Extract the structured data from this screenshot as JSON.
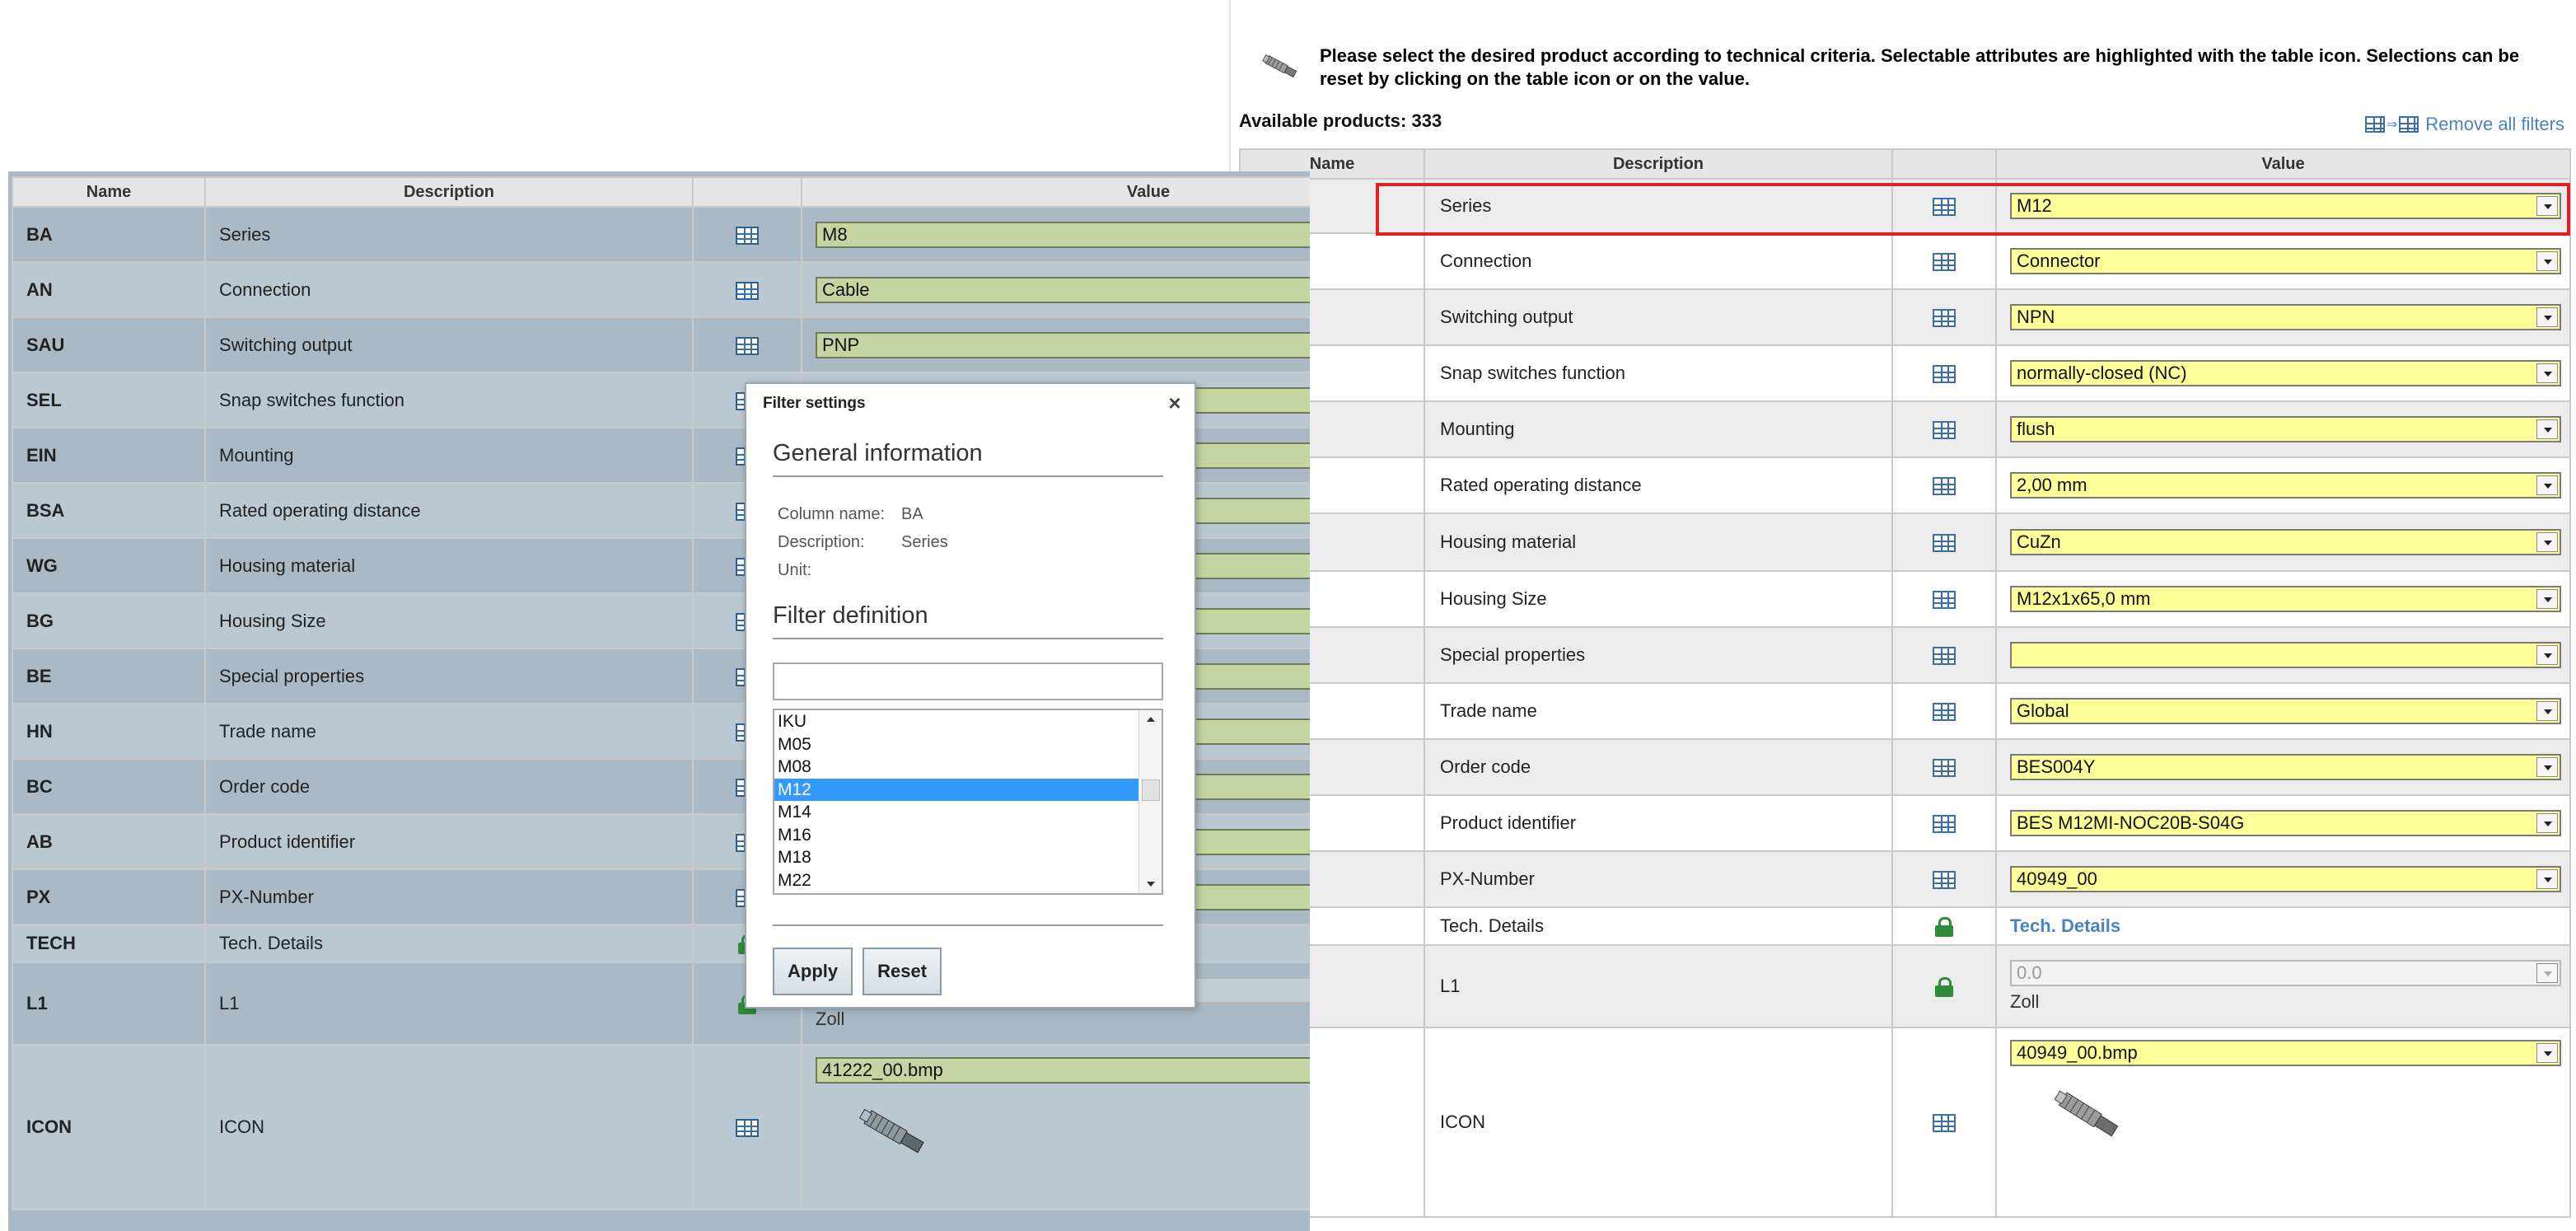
{
  "intro": {
    "text": "Please select the desired product according to technical criteria. Selectable attributes are highlighted with the table icon. Selections can be reset by clicking on the table icon or on the value."
  },
  "available": {
    "label": "Available products:",
    "count": "333"
  },
  "remove_all": "Remove all filters",
  "right_table": {
    "headers": {
      "name": "Name",
      "description": "Description",
      "value": "Value"
    },
    "rows": [
      {
        "description": "Series",
        "value": "M12"
      },
      {
        "description": "Connection",
        "value": "Connector"
      },
      {
        "description": "Switching output",
        "value": "NPN"
      },
      {
        "description": "Snap switches function",
        "value": "normally-closed (NC)"
      },
      {
        "description": "Mounting",
        "value": "flush"
      },
      {
        "description": "Rated operating distance",
        "value": "2,00 mm"
      },
      {
        "description": "Housing material",
        "value": "CuZn"
      },
      {
        "description": "Housing Size",
        "value": "M12x1x65,0 mm"
      },
      {
        "description": "Special properties",
        "value": ""
      },
      {
        "description": "Trade name",
        "value": "Global"
      },
      {
        "description": "Order code",
        "value": "BES004Y"
      },
      {
        "description": "Product identifier",
        "value": "BES M12MI-NOC20B-S04G"
      },
      {
        "description": "PX-Number",
        "value": "40949_00"
      }
    ],
    "tech": {
      "description": "Tech. Details",
      "link": "Tech. Details"
    },
    "l1": {
      "description": "L1",
      "value": "0.0",
      "unit": "Zoll"
    },
    "icon": {
      "description": "ICON",
      "value": "40949_00.bmp"
    }
  },
  "left_table": {
    "headers": {
      "name": "Name",
      "description": "Description",
      "value": "Value"
    },
    "rows": [
      {
        "name": "BA",
        "description": "Series",
        "value": "M8"
      },
      {
        "name": "AN",
        "description": "Connection",
        "value": "Cable"
      },
      {
        "name": "SAU",
        "description": "Switching output",
        "value": "PNP"
      },
      {
        "name": "SEL",
        "description": "Snap switches function",
        "value": ""
      },
      {
        "name": "EIN",
        "description": "Mounting",
        "value": ""
      },
      {
        "name": "BSA",
        "description": "Rated operating distance",
        "value": ""
      },
      {
        "name": "WG",
        "description": "Housing material",
        "value": ""
      },
      {
        "name": "BG",
        "description": "Housing Size",
        "value": ""
      },
      {
        "name": "BE",
        "description": "Special properties",
        "value": ""
      },
      {
        "name": "HN",
        "description": "Trade name",
        "value": ""
      },
      {
        "name": "BC",
        "description": "Order code",
        "value": ""
      },
      {
        "name": "AB",
        "description": "Product identifier",
        "value": ""
      },
      {
        "name": "PX",
        "description": "PX-Number",
        "value": ""
      }
    ],
    "tech": {
      "name": "TECH",
      "description": "Tech. Details"
    },
    "l1": {
      "name": "L1",
      "description": "L1",
      "unit": "Zoll"
    },
    "icon": {
      "name": "ICON",
      "description": "ICON",
      "value": "41222_00.bmp"
    }
  },
  "dialog": {
    "title": "Filter settings",
    "general_heading": "General information",
    "column_name_label": "Column name:",
    "column_name_value": "BA",
    "description_label": "Description:",
    "description_value": "Series",
    "unit_label": "Unit:",
    "unit_value": "",
    "filter_heading": "Filter definition",
    "filter_input_value": "",
    "options": [
      "IKU",
      "M05",
      "M08",
      "M12",
      "M14",
      "M16",
      "M18",
      "M22"
    ],
    "selected_option": "M12",
    "apply": "Apply",
    "reset": "Reset"
  },
  "colors": {
    "highlight": "#e31e24",
    "selected_value_bg": "#ffff99",
    "link": "#4a82c4",
    "list_selected": "#3399ff"
  }
}
